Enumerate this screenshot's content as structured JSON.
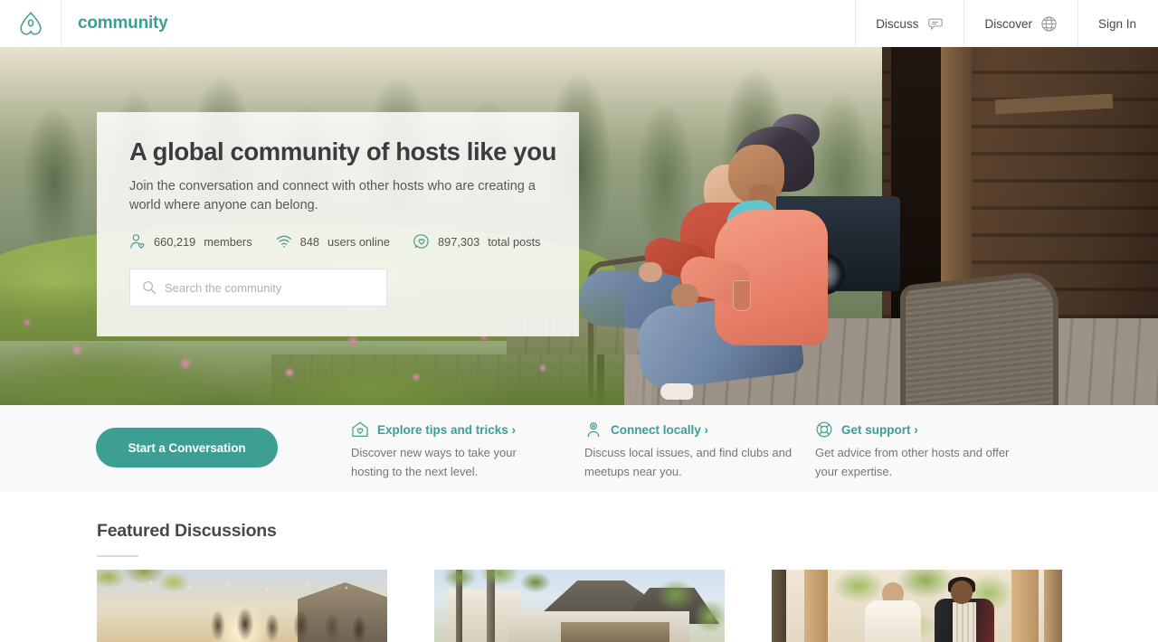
{
  "header": {
    "logo_icon": "airbnb-belo-icon",
    "brand": "community",
    "nav": [
      {
        "label": "Discuss",
        "icon": "speech-bubble-icon"
      },
      {
        "label": "Discover",
        "icon": "globe-icon"
      }
    ],
    "signin_label": "Sign In"
  },
  "hero": {
    "title": "A global community of hosts like you",
    "subtitle": "Join the conversation and connect with other hosts who are creating a world where anyone can belong.",
    "stats": [
      {
        "icon": "person-heart-icon",
        "value": "660,219",
        "label": "members"
      },
      {
        "icon": "wifi-icon",
        "value": "848",
        "label": "users online"
      },
      {
        "icon": "bubble-heart-icon",
        "value": "897,303",
        "label": "total posts"
      }
    ],
    "search": {
      "icon": "search-icon",
      "placeholder": "Search the community",
      "value": ""
    }
  },
  "actions": {
    "cta_label": "Start a Conversation",
    "items": [
      {
        "icon": "house-heart-icon",
        "link": "Explore tips and tricks ›",
        "desc": "Discover new ways to take your hosting to the next level."
      },
      {
        "icon": "location-person-icon",
        "link": "Connect locally ›",
        "desc": "Discuss local issues, and find clubs and meetups near you."
      },
      {
        "icon": "lifebuoy-icon",
        "link": "Get support ›",
        "desc": "Get advice from other hosts and offer your expertise."
      }
    ]
  },
  "featured": {
    "title": "Featured Discussions",
    "cards": [
      {
        "image_alt": "sunset-gathering-photo"
      },
      {
        "image_alt": "thatched-roof-house-photo"
      },
      {
        "image_alt": "hosts-greeting-guests-photo"
      }
    ]
  },
  "colors": {
    "brand_teal": "#3d9e93",
    "icon_teal": "#4a9d94",
    "text": "#484848",
    "muted": "#767676",
    "strip_bg": "#f9f9f9"
  }
}
